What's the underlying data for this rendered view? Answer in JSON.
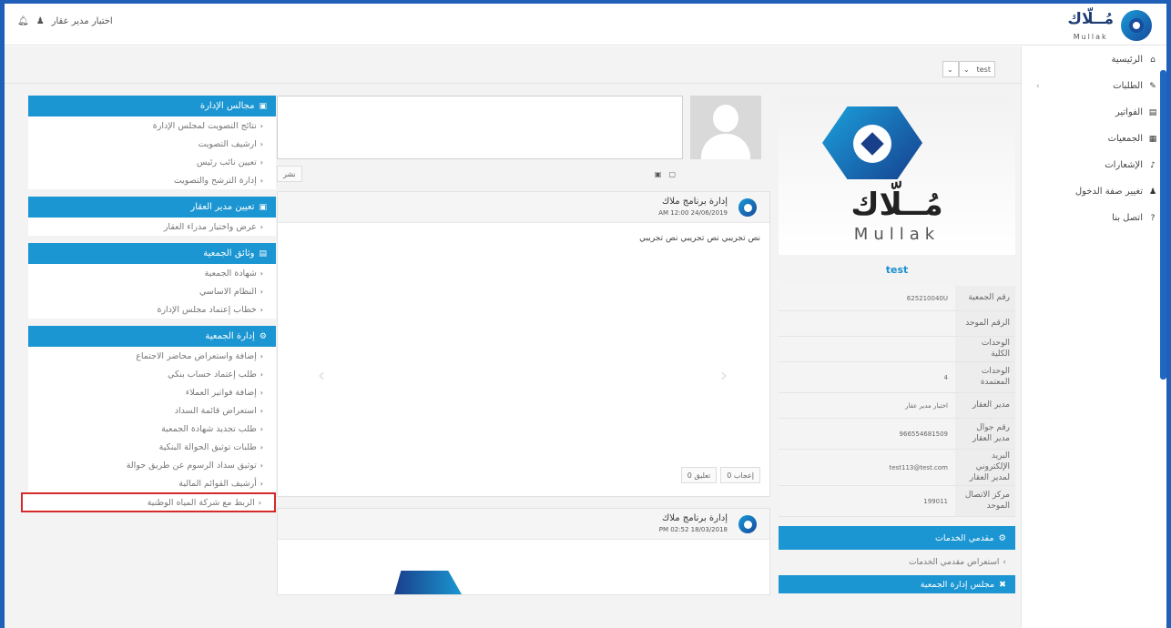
{
  "topbar": {
    "logo_ar": "مُــلّاك",
    "logo_en": "Mullak",
    "user_name": "اختبار مدير عقار"
  },
  "sidemenu": [
    {
      "label": "الرئيسية",
      "icon": "home-icon",
      "glyph": "⌂"
    },
    {
      "label": "الطلبات",
      "icon": "edit-icon",
      "glyph": "✎",
      "chevron": true
    },
    {
      "label": "الفواتير",
      "icon": "invoice-icon",
      "glyph": "▤"
    },
    {
      "label": "الجمعيات",
      "icon": "building-icon",
      "glyph": "▦"
    },
    {
      "label": "الإشعارات",
      "icon": "bell-icon",
      "glyph": "♪"
    },
    {
      "label": "تغيير صفة الدخول",
      "icon": "user-icon",
      "glyph": "♟"
    },
    {
      "label": "اتصل بنا",
      "icon": "question-icon",
      "glyph": "?"
    }
  ],
  "selector": {
    "value": "test"
  },
  "left": {
    "panels": [
      {
        "title": "مجالس الإدارة",
        "links": [
          "نتائج التصويت لمجلس الإدارة",
          "ارشيف التصويت",
          "تعيين نائب رئيس",
          "إدارة الترشح والتصويت"
        ]
      },
      {
        "title": "تعيين مدير العقار",
        "links": [
          "عرض واختيار مدراء العقار"
        ]
      },
      {
        "title": "وثائق الجمعية",
        "links": [
          "شهادة الجمعية",
          "النظام الاساسي",
          "خطاب إعتماد مجلس الإدارة"
        ]
      },
      {
        "title": "إدارة الجمعية",
        "links": [
          "إضافة واستعراض محاضر الاجتماع",
          "طلب إعتماد حساب بنكي",
          "إضافة فواتير العملاء",
          "استعراض قائمة السداد",
          "طلب تجديد شهادة الجمعية",
          "طلبات توثيق الحوالة البنكية",
          "توثيق سداد الرسوم عن طريق حوالة",
          "أرشيف القوائم المالية"
        ]
      }
    ],
    "highlight_link": "الربط مع شركة المياه الوطنية"
  },
  "feed": {
    "publish_label": "نشر",
    "posts": [
      {
        "author": "إدارة برنامج ملاك",
        "date": "AM 12:00 24/06/2019",
        "text": "نص تجريبي نص تجريبي نص تجريبي",
        "like_label": "0 إعجاب",
        "comment_label": "0 تعليق"
      },
      {
        "author": "إدارة برنامج ملاك",
        "date": "PM 02:52 18/03/2018"
      }
    ]
  },
  "right": {
    "logo_ar": "مُــلّاك",
    "logo_en": "Mullak",
    "association_name": "test",
    "info": [
      {
        "label": "رقم الجمعية",
        "value": "625210040U"
      },
      {
        "label": "الرقم الموحد",
        "value": ""
      },
      {
        "label": "الوحدات الكلية",
        "value": ""
      },
      {
        "label": "الوحدات المعتمدة",
        "value": "4"
      },
      {
        "label": "مدير العقار",
        "value": "اختبار مدير عقار"
      },
      {
        "label": "رقم جوال مدير العقار",
        "value": "966554681509"
      },
      {
        "label": "البريد الإلكتروني لمدير العقار",
        "value": "test113@test.com"
      },
      {
        "label": "مركز الاتصال الموحد",
        "value": "199011"
      }
    ],
    "providers_title": "مقدمي الخدمات",
    "providers_link": "استعراض مقدمي الخدمات",
    "board_title": "مجلس إدارة الجمعية"
  }
}
